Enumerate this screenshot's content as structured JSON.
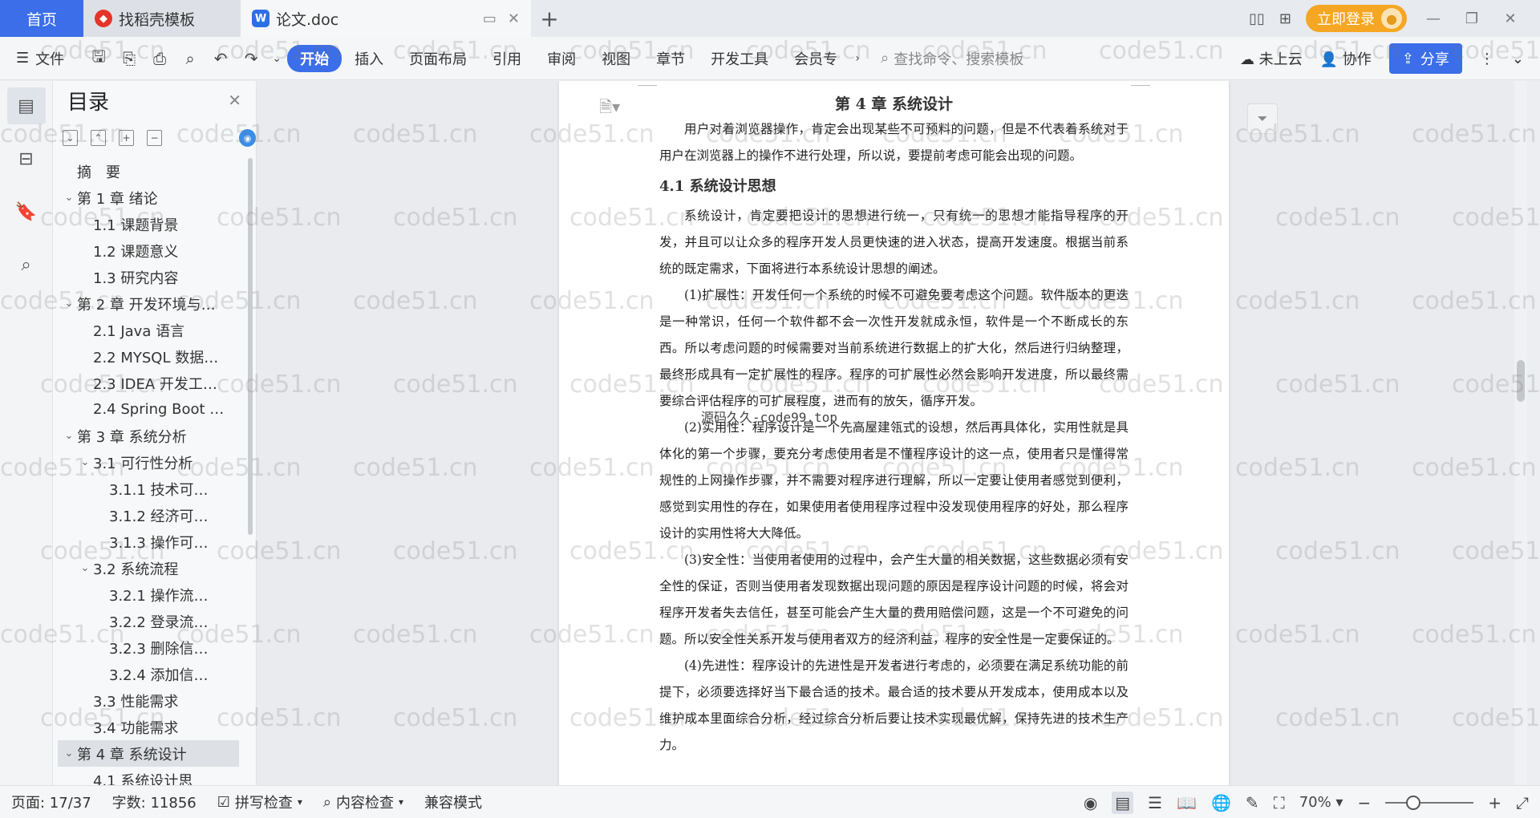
{
  "tabs": {
    "home": "首页",
    "templates": "找稻壳模板",
    "document": "论文.doc",
    "login": "立即登录"
  },
  "ribbon": {
    "file": "文件",
    "menus": [
      "开始",
      "插入",
      "页面布局",
      "引用",
      "审阅",
      "视图",
      "章节",
      "开发工具",
      "会员专"
    ],
    "search_placeholder": "查找命令、搜索模板",
    "cloud": "未上云",
    "collab": "协作",
    "share": "分享"
  },
  "toc": {
    "title": "目录",
    "items": [
      {
        "label": "摘　要",
        "level": 0,
        "chev": ""
      },
      {
        "label": "第 1 章  绪论",
        "level": 0,
        "chev": "⌄"
      },
      {
        "label": "1.1  课题背景",
        "level": 1,
        "chev": ""
      },
      {
        "label": "1.2  课题意义",
        "level": 1,
        "chev": ""
      },
      {
        "label": "1.3  研究内容",
        "level": 1,
        "chev": ""
      },
      {
        "label": "第 2 章  开发环境与…",
        "level": 0,
        "chev": "⌄"
      },
      {
        "label": "2.1 Java 语言",
        "level": 1,
        "chev": ""
      },
      {
        "label": "2.2 MYSQL 数据…",
        "level": 1,
        "chev": ""
      },
      {
        "label": "2.3 IDEA 开发工…",
        "level": 1,
        "chev": ""
      },
      {
        "label": "2.4 Spring Boot …",
        "level": 1,
        "chev": ""
      },
      {
        "label": "第 3 章  系统分析",
        "level": 0,
        "chev": "⌄"
      },
      {
        "label": "3.1  可行性分析",
        "level": 1,
        "chev": "⌄"
      },
      {
        "label": "3.1.1  技术可…",
        "level": 2,
        "chev": ""
      },
      {
        "label": "3.1.2  经济可…",
        "level": 2,
        "chev": ""
      },
      {
        "label": "3.1.3  操作可…",
        "level": 2,
        "chev": ""
      },
      {
        "label": "3.2  系统流程",
        "level": 1,
        "chev": "⌄"
      },
      {
        "label": "3.2.1  操作流…",
        "level": 2,
        "chev": ""
      },
      {
        "label": "3.2.2  登录流…",
        "level": 2,
        "chev": ""
      },
      {
        "label": "3.2.3  删除信…",
        "level": 2,
        "chev": ""
      },
      {
        "label": "3.2.4  添加信…",
        "level": 2,
        "chev": ""
      },
      {
        "label": "3.3  性能需求",
        "level": 1,
        "chev": ""
      },
      {
        "label": "3.4  功能需求",
        "level": 1,
        "chev": ""
      },
      {
        "label": "第 4 章  系统设计",
        "level": 0,
        "chev": "⌄",
        "selected": true
      },
      {
        "label": "4.1  系统设计思",
        "level": 1,
        "chev": ""
      }
    ]
  },
  "document": {
    "chapter_title": "第 4 章  系统设计",
    "intro": "用户对着浏览器操作，肯定会出现某些不可预料的问题，但是不代表着系统对于用户在浏览器上的操作不进行处理，所以说，要提前考虑可能会出现的问题。",
    "section_title": "4.1  系统设计思想",
    "paragraphs": [
      "系统设计，肯定要把设计的思想进行统一，只有统一的思想才能指导程序的开发，并且可以让众多的程序开发人员更快速的进入状态，提高开发速度。根据当前系统的既定需求，下面将进行本系统设计思想的阐述。",
      "(1)扩展性：开发任何一个系统的时候不可避免要考虑这个问题。软件版本的更迭是一种常识，任何一个软件都不会一次性开发就成永恒，软件是一个不断成长的东西。所以考虑问题的时候需要对当前系统进行数据上的扩大化，然后进行归纳整理，最终形成具有一定扩展性的程序。程序的可扩展性必然会影响开发进度，所以最终需要综合评估程序的可扩展程度，进而有的放矢，循序开发。",
      "(2)实用性：程序设计是一个先高屋建瓴式的设想，然后再具体化，实用性就是具体化的第一个步骤，要充分考虑使用者是不懂程序设计的这一点，使用者只是懂得常规性的上网操作步骤，并不需要对程序进行理解，所以一定要让使用者感觉到便利，感觉到实用性的存在，如果使用者使用程序过程中没发现使用程序的好处，那么程序设计的实用性将大大降低。",
      "(3)安全性：当使用者使用的过程中，会产生大量的相关数据，这些数据必须有安全性的保证，否则当使用者发现数据出现问题的原因是程序设计问题的时候，将会对程序开发者失去信任，甚至可能会产生大量的费用赔偿问题，这是一个不可避免的问题。所以安全性关系开发与使用者双方的经济利益，程序的安全性是一定要保证的。",
      "(4)先进性：程序设计的先进性是开发者进行考虑的，必须要在满足系统功能的前提下，必须要选择好当下最合适的技术。最合适的技术要从开发成本，使用成本以及维护成本里面综合分析，经过综合分析后要让技术实现最优解，保持先进的技术生产力。"
    ],
    "source_mark": "源码久久-code99.top",
    "watermark": "code51.cn"
  },
  "status": {
    "page": "页面: 17/37",
    "words": "字数: 11856",
    "spell": "拼写检查",
    "content_check": "内容检查",
    "compat": "兼容模式",
    "zoom": "70%",
    "zoom_level": 0.7
  }
}
